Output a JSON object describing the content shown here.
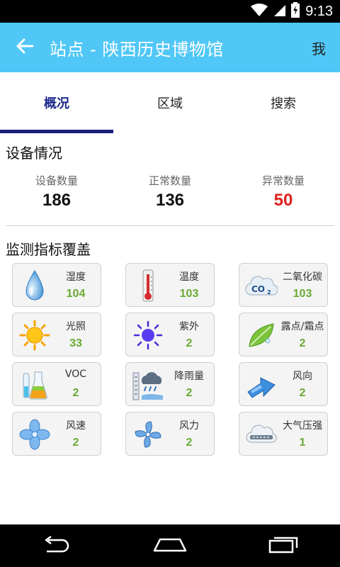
{
  "status_bar": {
    "time": "9:13",
    "icons": [
      "wifi-icon",
      "signal-icon",
      "battery-icon"
    ]
  },
  "header": {
    "title": "站点 - 陕西历史博物馆",
    "right_label": "我",
    "back_icon": "back-arrow-icon",
    "color": "#50c7f7"
  },
  "tabs": [
    {
      "label": "概况",
      "active": true
    },
    {
      "label": "区域",
      "active": false
    },
    {
      "label": "搜索",
      "active": false
    }
  ],
  "device_section": {
    "title": "设备情况",
    "stats": [
      {
        "label": "设备数量",
        "value": "186"
      },
      {
        "label": "正常数量",
        "value": "136"
      },
      {
        "label": "异常数量",
        "value": "50",
        "color": "#e0201c"
      }
    ]
  },
  "monitor_section": {
    "title": "监测指标覆盖",
    "items": [
      {
        "name": "湿度",
        "count": "104",
        "icon": "water-drop-icon"
      },
      {
        "name": "温度",
        "count": "103",
        "icon": "thermometer-icon"
      },
      {
        "name": "二氧化碳",
        "count": "103",
        "icon": "co2-cloud-icon"
      },
      {
        "name": "光照",
        "count": "33",
        "icon": "sun-icon"
      },
      {
        "name": "紫外",
        "count": "2",
        "icon": "uv-sun-icon"
      },
      {
        "name": "露点/霜点",
        "count": "2",
        "icon": "leaf-icon"
      },
      {
        "name": "VOC",
        "count": "2",
        "icon": "flask-icon"
      },
      {
        "name": "降雨量",
        "count": "2",
        "icon": "rain-gauge-icon"
      },
      {
        "name": "风向",
        "count": "2",
        "icon": "wind-arrow-icon"
      },
      {
        "name": "风速",
        "count": "2",
        "icon": "fan-icon"
      },
      {
        "name": "风力",
        "count": "2",
        "icon": "pinwheel-icon"
      },
      {
        "name": "大气压强",
        "count": "1",
        "icon": "pressure-icon"
      }
    ],
    "count_color": "#6aa934"
  },
  "nav_bar": {
    "buttons": [
      "back-nav-icon",
      "home-nav-icon",
      "recents-nav-icon"
    ]
  }
}
